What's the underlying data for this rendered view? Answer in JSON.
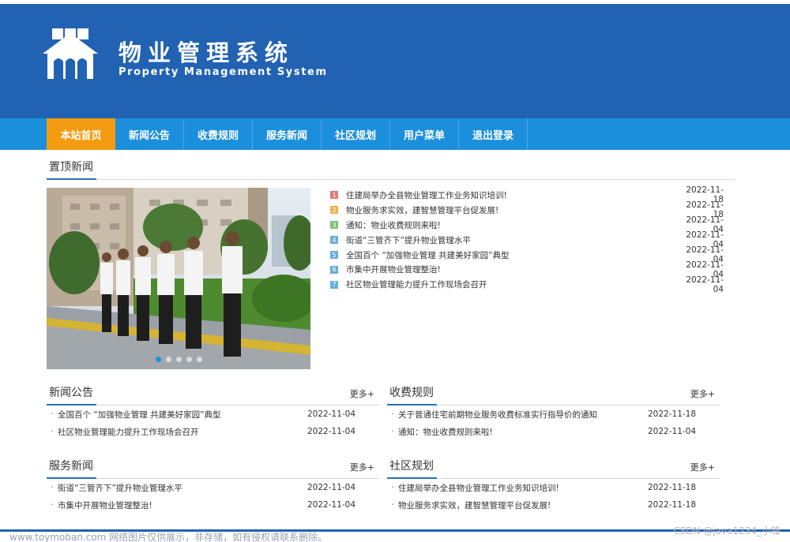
{
  "header": {
    "title": "物业管理系统",
    "subtitle": "Property Management System"
  },
  "nav": {
    "items": [
      "本站首页",
      "新闻公告",
      "收费规则",
      "服务新闻",
      "社区规划",
      "用户菜单",
      "退出登录"
    ],
    "active_index": 0
  },
  "top_news": {
    "heading": "置顶新闻",
    "items": [
      {
        "num": "1",
        "title": "住建局举办全县物业管理工作业务知识培训!",
        "date": "2022-11-18",
        "color": "#e07a7a"
      },
      {
        "num": "2",
        "title": "物业服务求实效，建智慧管理平台促发展!",
        "date": "2022-11-18",
        "color": "#f0b34a"
      },
      {
        "num": "3",
        "title": "通知：物业收费规则来啦!",
        "date": "2022-11-04",
        "color": "#7cc576"
      },
      {
        "num": "4",
        "title": "街道“三管齐下”提升物业管理水平",
        "date": "2022-11-04",
        "color": "#6aaed8"
      },
      {
        "num": "5",
        "title": "全国百个 “加强物业管理 共建美好家园”典型",
        "date": "2022-11-04",
        "color": "#6aaed8"
      },
      {
        "num": "6",
        "title": "市集中开展物业管理整治!",
        "date": "2022-11-04",
        "color": "#6aaed8"
      },
      {
        "num": "7",
        "title": "社区物业管理能力提升工作现场会召开",
        "date": "2022-11-04",
        "color": "#6aaed8"
      }
    ],
    "carousel_dots": 5,
    "carousel_active": 0
  },
  "sections": {
    "notice": {
      "heading": "新闻公告",
      "more": "更多+",
      "items": [
        {
          "title": "全国百个 “加强物业管理 共建美好家园”典型",
          "date": "2022-11-04"
        },
        {
          "title": "社区物业管理能力提升工作现场会召开",
          "date": "2022-11-04"
        }
      ]
    },
    "fees": {
      "heading": "收费规则",
      "more": "更多+",
      "items": [
        {
          "title": "关于普通住宅前期物业服务收费标准实行指导价的通知",
          "date": "2022-11-18"
        },
        {
          "title": "通知：物业收费规则来啦!",
          "date": "2022-11-04"
        }
      ]
    },
    "service": {
      "heading": "服务新闻",
      "more": "更多+",
      "items": [
        {
          "title": "街道“三管齐下”提升物业管理水平",
          "date": "2022-11-04"
        },
        {
          "title": "市集中开展物业管理整治!",
          "date": "2022-11-04"
        }
      ]
    },
    "planning": {
      "heading": "社区规划",
      "more": "更多+",
      "items": [
        {
          "title": "住建局举办全县物业管理工作业务知识培训!",
          "date": "2022-11-18"
        },
        {
          "title": "物业服务求实效，建智慧管理平台促发展!",
          "date": "2022-11-18"
        }
      ]
    }
  },
  "watermark": {
    "left": "www.toymoban.com 网络图片仅供展示，非存储，如有侵权请联系删除。",
    "right": "CSDN @java1234_小锋"
  },
  "colors": {
    "header_bg": "#2262b3",
    "nav_bg": "#1c8fdc",
    "nav_active": "#f39c12",
    "accent": "#2a6fc0"
  }
}
